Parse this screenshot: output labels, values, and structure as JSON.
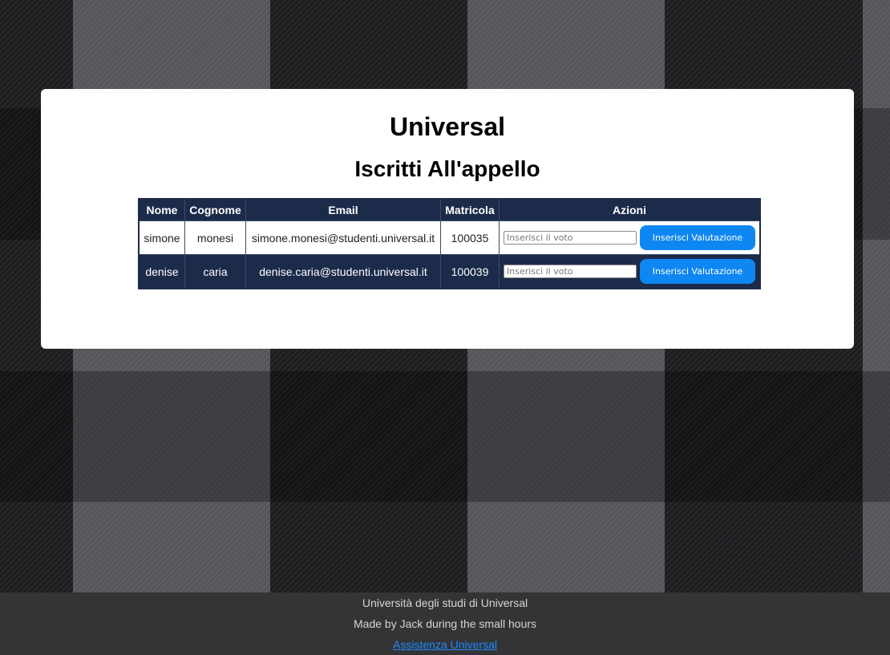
{
  "header": {
    "title": "Universal",
    "subtitle": "Iscritti All'appello"
  },
  "table": {
    "columns": [
      "Nome",
      "Cognome",
      "Email",
      "Matricola",
      "Azioni"
    ],
    "rows": [
      {
        "nome": "simone",
        "cognome": "monesi",
        "email": "simone.monesi@studenti.universal.it",
        "matricola": "100035",
        "grade_placeholder": "Inserisci il voto",
        "grade_value": "",
        "button_label": "Inserisci Valutazione"
      },
      {
        "nome": "denise",
        "cognome": "caria",
        "email": "denise.caria@studenti.universal.it",
        "matricola": "100039",
        "grade_placeholder": "Inserisci il voto",
        "grade_value": "",
        "button_label": "Inserisci Valutazione"
      }
    ]
  },
  "footer": {
    "university": "Università degli studi di Universal",
    "credits": "Made by Jack during the small hours",
    "support_link": "Assistenza Universal"
  },
  "colors": {
    "table_header_bg": "#1c2b4a",
    "button_bg": "#0f87f2",
    "link": "#1a8cff",
    "footer_bg": "#343436"
  }
}
